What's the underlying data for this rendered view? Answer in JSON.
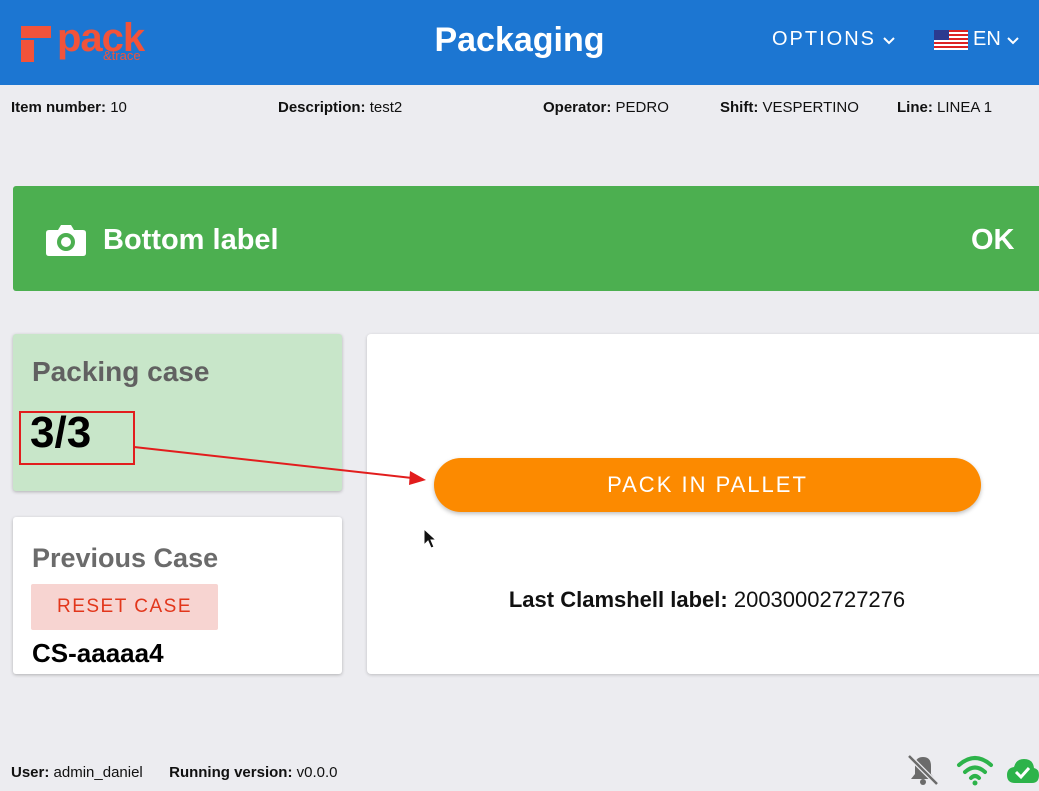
{
  "header": {
    "logo_word": "pack",
    "logo_sub": "&trace",
    "title": "Packaging",
    "options_label": "OPTIONS",
    "language": "EN"
  },
  "info": {
    "item_number_label": "Item number:",
    "item_number": "10",
    "description_label": "Description:",
    "description": "test2",
    "operator_label": "Operator:",
    "operator": "PEDRO",
    "shift_label": "Shift:",
    "shift": "VESPERTINO",
    "line_label": "Line:",
    "line": "LINEA 1"
  },
  "status": {
    "label": "Bottom label",
    "value": "OK",
    "color": "#4caf50"
  },
  "packing_case": {
    "title": "Packing case",
    "count": "3/3"
  },
  "previous_case": {
    "title": "Previous Case",
    "reset_label": "RESET CASE",
    "code": "CS-aaaaa4"
  },
  "main": {
    "pack_button_label": "PACK IN PALLET",
    "last_label_title": "Last Clamshell label:",
    "last_label_value": "20030002727276"
  },
  "footer": {
    "user_label": "User:",
    "user": "admin_daniel",
    "version_label": "Running version:",
    "version": "v0.0.0",
    "icons": [
      "bell-off-icon",
      "wifi-icon",
      "cloud-check-icon"
    ]
  },
  "colors": {
    "header": "#1c76d2",
    "accent_orange": "#fc8a00",
    "success_green": "#4caf50",
    "annotation_red": "#e21d1d"
  }
}
